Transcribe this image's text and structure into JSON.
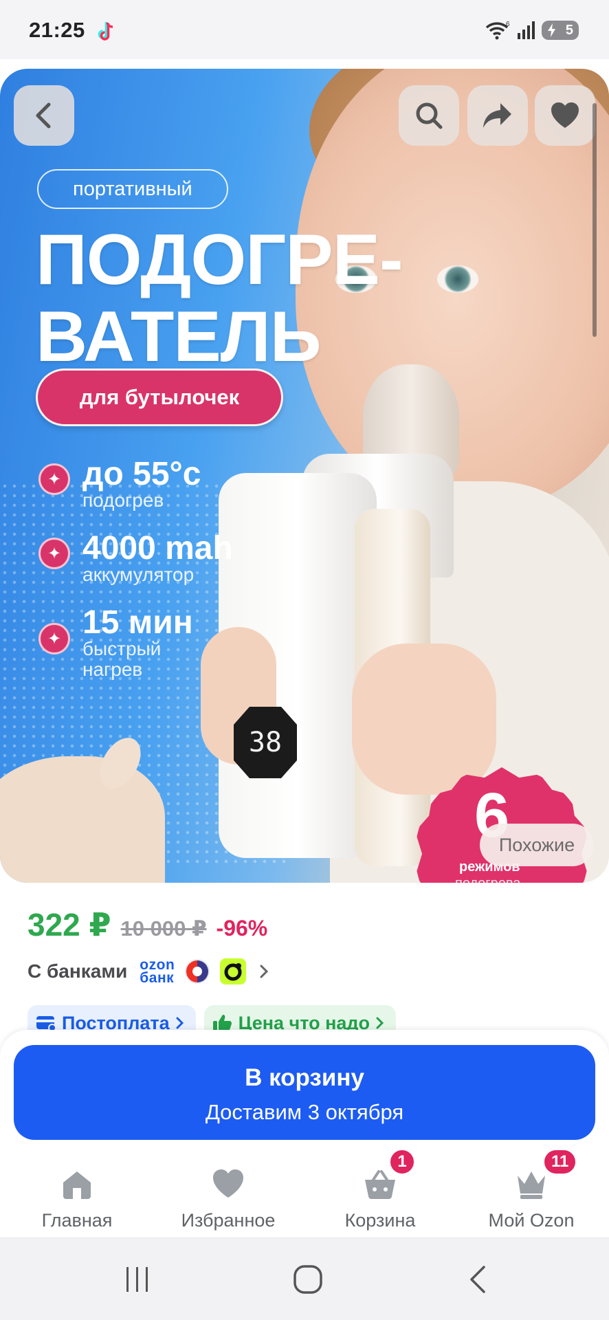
{
  "status_bar": {
    "time": "21:25",
    "battery_level": "5"
  },
  "hero": {
    "product_tag": "портативный",
    "headline_line1": "ПОДОГРЕ-",
    "headline_line2": "ВАТЕЛЬ",
    "subtitle_pill": "для бутылочек",
    "features": [
      {
        "big": "до 55°с",
        "small": "подогрев"
      },
      {
        "big": "4000 mah",
        "small": "аккумулятор"
      },
      {
        "big": "15 мин",
        "small": "быстрый",
        "small2": "нагрев"
      }
    ],
    "display_reading": "38",
    "modes_badge": {
      "number": "6",
      "label": "режимов",
      "label2": "подогрева"
    },
    "similar_button": "Похожие"
  },
  "price": {
    "current": "322 ₽",
    "old": "10 000 ₽",
    "discount": "-96%"
  },
  "banks": {
    "label": "С банками",
    "ozon_bank_line1": "ozon",
    "ozon_bank_line2": "банк"
  },
  "chips": {
    "postpay": "Постоплата",
    "good_price": "Цена что надо"
  },
  "cart_button": {
    "title": "В корзину",
    "subtitle": "Доставим 3 октября"
  },
  "bottom_nav": {
    "items": [
      {
        "label": "Главная",
        "icon": "home-icon"
      },
      {
        "label": "Избранное",
        "icon": "heart-icon"
      },
      {
        "label": "Корзина",
        "icon": "basket-icon",
        "badge": "1"
      },
      {
        "label": "Мой Ozon",
        "icon": "crown-icon",
        "badge": "11"
      }
    ]
  },
  "colors": {
    "accent_blue": "#1d5cf2",
    "price_green": "#2fa84f",
    "discount_pink": "#e0245e"
  }
}
